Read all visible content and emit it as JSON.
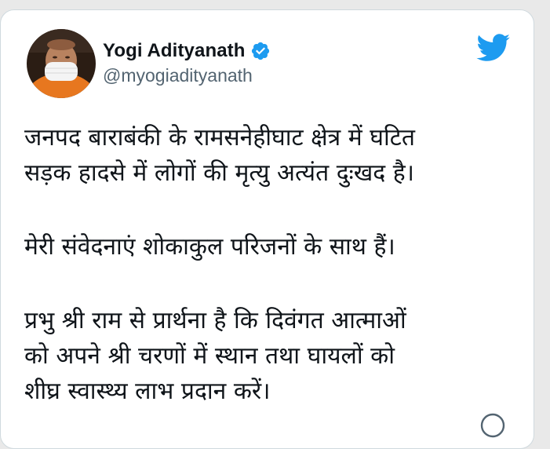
{
  "tweet": {
    "author": {
      "display_name": "Yogi Adityanath",
      "handle": "@myogiadityanath",
      "verified": true,
      "avatar_icon": "profile-photo",
      "verified_icon": "verified-badge-icon"
    },
    "platform_icon": "twitter-bird-icon",
    "paragraphs": [
      [
        "जनपद बाराबंकी के रामसनेहीघाट क्षेत्र में घटित",
        "सड़क हादसे में लोगों की मृत्यु अत्यंत दुःखद है।"
      ],
      [
        "मेरी संवेदनाएं शोकाकुल परिजनों के साथ हैं।"
      ],
      [
        "प्रभु श्री राम से प्रार्थना है कि दिवंगत आत्माओं",
        "को अपने श्री चरणों में स्थान तथा घायलों को",
        "शीघ्र स्वास्थ्य लाभ प्रदान करें।"
      ]
    ]
  },
  "colors": {
    "text": "#0f1419",
    "secondary_text": "#536471",
    "brand_blue": "#1d9bf0",
    "card_border": "#cfd9de"
  }
}
